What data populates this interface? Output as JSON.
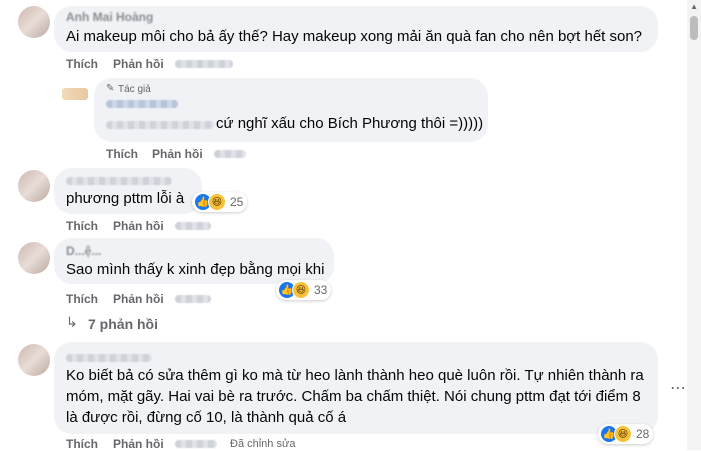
{
  "actions": {
    "like": "Thích",
    "reply": "Phản hồi"
  },
  "comments": [
    {
      "author": "Anh Mai Hoàng",
      "text": "Ai makeup môi cho bả ấy thế? Hay makeup xong mải ăn quà fan cho nên bợt hết son?"
    },
    {
      "author_badge": "Tác giả",
      "text_visible": "cứ nghĩ xấu cho Bích Phương thôi =)))))"
    },
    {
      "text": "phương pttm lỗi à",
      "reaction_count": "25"
    },
    {
      "author": "D...ệ...",
      "text": "Sao mình thấy k xinh đẹp bằng mọi khi",
      "reaction_count": "33",
      "replies_label": "7 phản hồi"
    },
    {
      "text_lines": [
        "Ko biết bả có sửa thêm gì ko mà từ heo lành thành heo què luôn rồi. Tự nhiên thành ra",
        "móm, mặt gãy. Hai vai bè ra trước. Chấm ba chấm thiệt. Nói chung pttm đạt tới điểm 8",
        "là được rồi, đừng cố 10, là thành quả cố á"
      ],
      "edited_label": "Đã chỉnh sửa",
      "reaction_count": "28"
    }
  ],
  "icons": {
    "like": "like-icon",
    "haha": "haha-icon",
    "more": "more-options-icon",
    "reply_arrow": "reply-arrow-icon",
    "pencil": "pencil-icon"
  },
  "colors": {
    "like": "#1877f2",
    "haha": "#f7c23a",
    "bubble": "#f0f2f5",
    "meta": "#65676b"
  }
}
